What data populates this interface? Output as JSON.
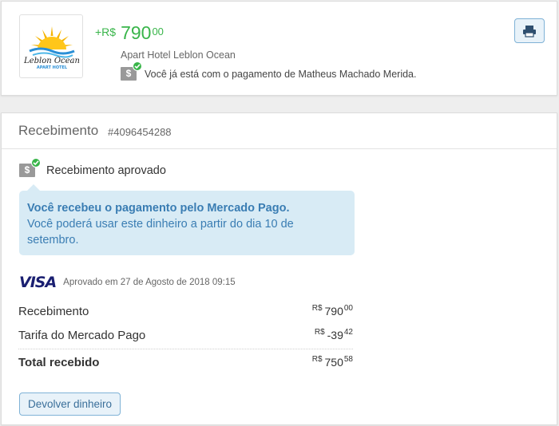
{
  "payment": {
    "amount_prefix": "+R$",
    "amount_int": "790",
    "amount_cents": "00",
    "hotel_name": "Apart Hotel Leblon Ocean",
    "notice": "Você já está com o pagamento de Matheus Machado Merida."
  },
  "logo": {
    "name": "Leblon Ocean",
    "tagline": "APART HOTEL"
  },
  "icons": {
    "money": "$",
    "print": "print-icon",
    "check": "check-icon"
  },
  "receipt": {
    "title": "Recebimento",
    "id": "#4096454288",
    "status": "Recebimento aprovado",
    "bubble_title": "Você recebeu o pagamento pelo Mercado Pago.",
    "bubble_text": "Você poderá usar este dinheiro a partir do dia 10 de setembro.",
    "card_brand": "VISA",
    "approved_text": "Aprovado em 27 de Agosto de 2018 09:15",
    "lines": [
      {
        "label": "Recebimento",
        "currency": "R$",
        "int": "790",
        "cents": "00"
      },
      {
        "label": "Tarifa do Mercado Pago",
        "currency": "R$",
        "int": "-39",
        "cents": "42"
      },
      {
        "label": "Total recebido",
        "currency": "R$",
        "int": "750",
        "cents": "58"
      }
    ],
    "refund_button": "Devolver dinheiro"
  },
  "colors": {
    "positive": "#39b54a",
    "info_text": "#3a7db3",
    "info_bg": "#d8ebf5",
    "visa": "#1a1f71"
  }
}
